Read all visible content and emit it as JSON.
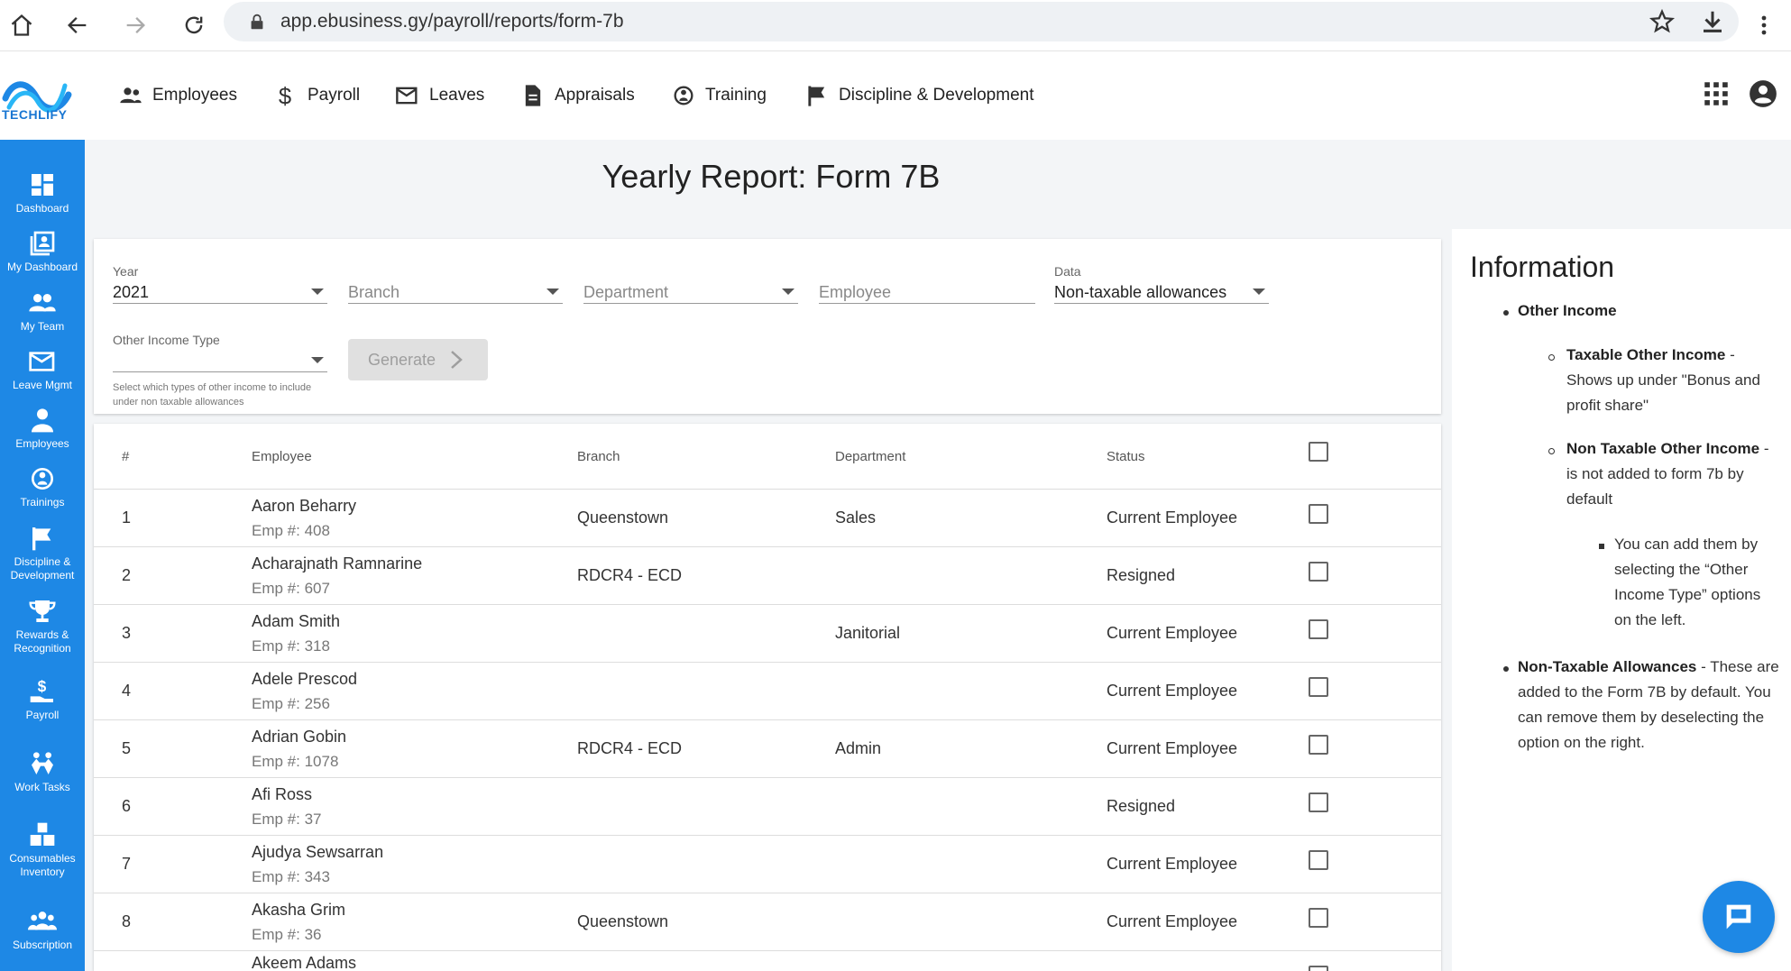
{
  "browser": {
    "url": "app.ebusiness.gy/payroll/reports/form-7b"
  },
  "app": {
    "logo_text": "TECHLIFY",
    "topnav": [
      {
        "label": "Employees",
        "icon": "people-icon"
      },
      {
        "label": "Payroll",
        "icon": "dollar-icon"
      },
      {
        "label": "Leaves",
        "icon": "mail-icon"
      },
      {
        "label": "Appraisals",
        "icon": "document-icon"
      },
      {
        "label": "Training",
        "icon": "training-icon"
      },
      {
        "label": "Discipline & Development",
        "icon": "flag-icon"
      }
    ]
  },
  "sidebar": {
    "items": [
      {
        "label": "Dashboard",
        "icon": "dashboard-icon"
      },
      {
        "label": "My Dashboard",
        "icon": "my-dashboard-icon"
      },
      {
        "label": "My Team",
        "icon": "team-icon"
      },
      {
        "label": "Leave Mgmt",
        "icon": "mail-icon"
      },
      {
        "label": "Employees",
        "icon": "person-icon"
      },
      {
        "label": "Trainings",
        "icon": "training-icon"
      },
      {
        "label": "Discipline & Development",
        "icon": "flag-icon"
      },
      {
        "label": "Rewards & Recognition",
        "icon": "trophy-icon"
      },
      {
        "label": "Payroll",
        "icon": "payroll-icon"
      },
      {
        "label": "Work Tasks",
        "icon": "work-tasks-icon"
      },
      {
        "label": "Consumables Inventory",
        "icon": "inventory-icon"
      },
      {
        "label": "Subscription",
        "icon": "subscription-icon"
      }
    ]
  },
  "page": {
    "title": "Yearly Report: Form 7B"
  },
  "filters": {
    "year_label": "Year",
    "year_value": "2021",
    "branch_placeholder": "Branch",
    "department_placeholder": "Department",
    "employee_placeholder": "Employee",
    "data_label": "Data",
    "data_value": "Non-taxable allowances",
    "other_income_label": "Other Income Type",
    "other_income_helper": "Select which types of other income to include under non taxable allowances",
    "generate_label": "Generate"
  },
  "table": {
    "headers": {
      "num": "#",
      "employee": "Employee",
      "branch": "Branch",
      "department": "Department",
      "status": "Status"
    },
    "rows": [
      {
        "num": "1",
        "name": "Aaron Beharry",
        "emp": "Emp #: 408",
        "branch": "Queenstown",
        "department": "Sales",
        "status": "Current Employee"
      },
      {
        "num": "2",
        "name": "Acharajnath Ramnarine",
        "emp": "Emp #: 607",
        "branch": "RDCR4 - ECD",
        "department": "",
        "status": "Resigned"
      },
      {
        "num": "3",
        "name": "Adam Smith",
        "emp": "Emp #: 318",
        "branch": "",
        "department": "Janitorial",
        "status": "Current Employee"
      },
      {
        "num": "4",
        "name": "Adele Prescod",
        "emp": "Emp #: 256",
        "branch": "",
        "department": "",
        "status": "Current Employee"
      },
      {
        "num": "5",
        "name": "Adrian Gobin",
        "emp": "Emp #: 1078",
        "branch": "RDCR4 - ECD",
        "department": "Admin",
        "status": "Current Employee"
      },
      {
        "num": "6",
        "name": "Afi Ross",
        "emp": "Emp #: 37",
        "branch": "",
        "department": "",
        "status": "Resigned"
      },
      {
        "num": "7",
        "name": "Ajudya Sewsarran",
        "emp": "Emp #: 343",
        "branch": "",
        "department": "",
        "status": "Current Employee"
      },
      {
        "num": "8",
        "name": "Akasha Grim",
        "emp": "Emp #: 36",
        "branch": "Queenstown",
        "department": "",
        "status": "Current Employee"
      },
      {
        "num": "",
        "name": "Akeem Adams",
        "emp": "",
        "branch": "",
        "department": "",
        "status": ""
      }
    ]
  },
  "info": {
    "title": "Information",
    "other_income": "Other Income",
    "taxable_bold": "Taxable Other Income",
    "taxable_text": " - Shows up under \"Bonus and profit share\"",
    "nontaxable_bold": "Non Taxable Other Income",
    "nontaxable_text": " - is not added to form 7b by default",
    "add_text": "You can add them by selecting the “Other Income Type” options on the left.",
    "nta_bold": "Non-Taxable Allowances",
    "nta_text": " - These are added to the Form 7B by default. You can remove them by deselecting the option on the right."
  }
}
